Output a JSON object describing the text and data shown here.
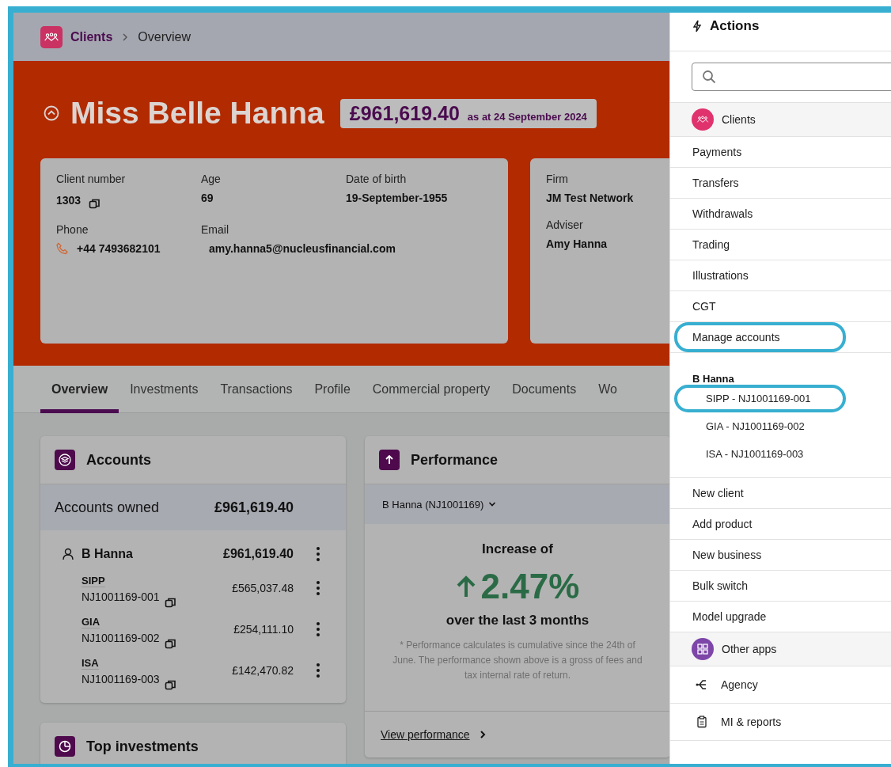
{
  "breadcrumb": [
    {
      "label": "Clients",
      "kind": "app"
    },
    {
      "label": "Overview",
      "kind": "current"
    }
  ],
  "client": {
    "name": "Miss Belle Hanna",
    "valuation": "£961,619.40",
    "as_at": "as at 24 September 2024"
  },
  "detail_cards": [
    {
      "fields": [
        {
          "label": "Client number",
          "value": "1303",
          "kind": "plain",
          "copyable": true
        },
        {
          "label": "Age",
          "value": "69",
          "kind": "plain",
          "copyable": false
        },
        {
          "label": "Date of birth",
          "value": "19-September-1955",
          "kind": "plain",
          "copyable": false
        },
        {
          "label": "Phone",
          "value": "+44 7493682101",
          "kind": "phone",
          "copyable": false
        },
        {
          "label": "Email",
          "value": "amy.hanna5@nucleusfinancial.com",
          "kind": "email",
          "copyable": false
        }
      ]
    },
    {
      "fields": [
        {
          "label": "Firm",
          "value": "JM Test Network",
          "kind": "plain",
          "copyable": false
        },
        {
          "label": "Adviser",
          "value": "Amy Hanna",
          "kind": "plain",
          "copyable": false
        }
      ]
    }
  ],
  "tabs": [
    {
      "label": "Overview",
      "selected": true
    },
    {
      "label": "Investments",
      "selected": false
    },
    {
      "label": "Transactions",
      "selected": false
    },
    {
      "label": "Profile",
      "selected": false
    },
    {
      "label": "Commercial property",
      "selected": false
    },
    {
      "label": "Documents",
      "selected": false
    },
    {
      "label": "Wo",
      "selected": false
    }
  ],
  "accounts_card": {
    "title": "Accounts",
    "owned_label": "Accounts owned",
    "owned_total": "£961,619.40",
    "owner": {
      "name": "B Hanna",
      "total": "£961,619.40"
    },
    "accounts": [
      {
        "type": "SIPP",
        "number": "NJ1001169-001",
        "value": "£565,037.48"
      },
      {
        "type": "GIA",
        "number": "NJ1001169-002",
        "value": "£254,111.10"
      },
      {
        "type": "ISA",
        "number": "NJ1001169-003",
        "value": "£142,470.82"
      }
    ]
  },
  "performance_card": {
    "title": "Performance",
    "selector": "B Hanna (NJ1001169)",
    "headline": "Increase of",
    "change": "2.47%",
    "period": "over the last 3 months",
    "note": "* Performance calculates is cumulative since the 24th of June. The performance shown above is a gross of fees and tax internal rate of return.",
    "link": "View performance"
  },
  "top_investments_card": {
    "title": "Top investments"
  },
  "actions": {
    "title": "Actions",
    "items": [
      {
        "kind": "app",
        "label": "Clients",
        "color": "#e0336d"
      },
      {
        "kind": "item",
        "label": "Payments",
        "highlighted": false
      },
      {
        "kind": "item",
        "label": "Transfers",
        "highlighted": false
      },
      {
        "kind": "item",
        "label": "Withdrawals",
        "highlighted": false
      },
      {
        "kind": "item",
        "label": "Trading",
        "highlighted": false
      },
      {
        "kind": "item",
        "label": "Illustrations",
        "highlighted": false
      },
      {
        "kind": "item",
        "label": "CGT",
        "highlighted": false
      },
      {
        "kind": "item",
        "label": "Manage accounts",
        "highlighted": true
      },
      {
        "kind": "group",
        "label": "B Hanna",
        "children": [
          {
            "label": "SIPP - NJ1001169-001",
            "highlighted": true
          },
          {
            "label": "GIA - NJ1001169-002",
            "highlighted": false
          },
          {
            "label": "ISA - NJ1001169-003",
            "highlighted": false
          }
        ]
      },
      {
        "kind": "item",
        "label": "New client",
        "highlighted": false
      },
      {
        "kind": "item",
        "label": "Add product",
        "highlighted": false
      },
      {
        "kind": "item",
        "label": "New business",
        "highlighted": false
      },
      {
        "kind": "item",
        "label": "Bulk switch",
        "highlighted": false
      },
      {
        "kind": "item",
        "label": "Model upgrade",
        "highlighted": false
      },
      {
        "kind": "app",
        "label": "Other apps",
        "color": "#7d46a8"
      },
      {
        "kind": "tool",
        "label": "Agency"
      },
      {
        "kind": "tool",
        "label": "MI & reports"
      }
    ]
  }
}
